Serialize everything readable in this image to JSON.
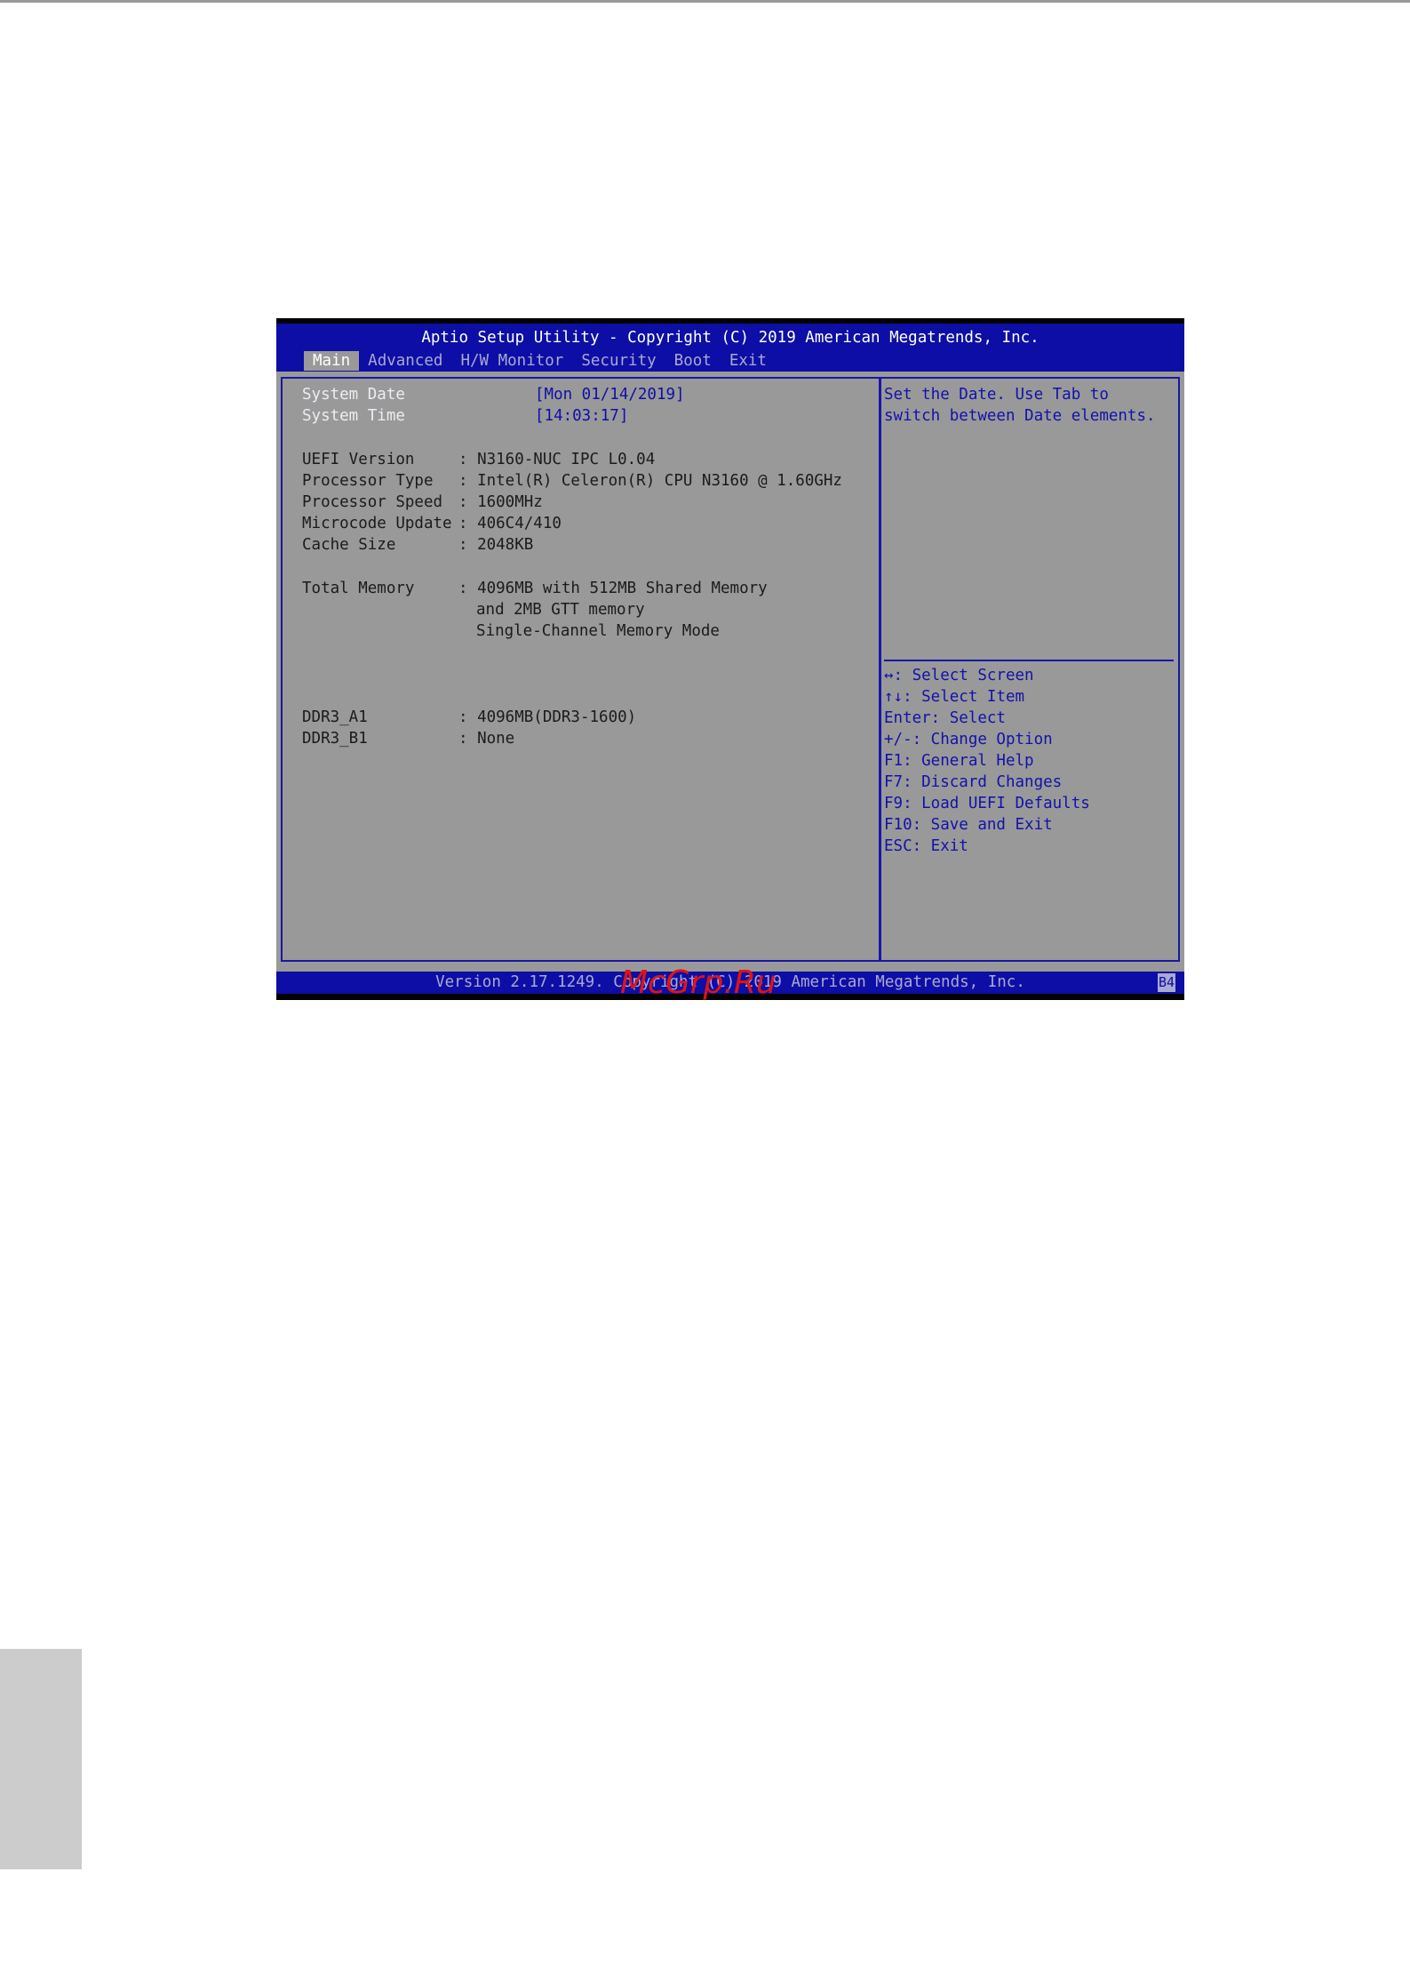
{
  "header": {
    "title": "Aptio Setup Utility - Copyright (C) 2019 American Megatrends, Inc.",
    "tabs": [
      "Main",
      "Advanced",
      "H/W Monitor",
      "Security",
      "Boot",
      "Exit"
    ],
    "active_tab": "Main"
  },
  "main": {
    "system_date_label": "System Date",
    "system_date_value": "[Mon 01/14/2019]",
    "system_time_label": "System Time",
    "system_time_value": "[14:03:17]",
    "info": [
      {
        "label": "UEFI Version",
        "value": ": N3160-NUC IPC L0.04"
      },
      {
        "label": "Processor Type",
        "value": ": Intel(R) Celeron(R) CPU N3160 @ 1.60GHz"
      },
      {
        "label": "Processor Speed",
        "value": ": 1600MHz"
      },
      {
        "label": "Microcode Update",
        "value": ": 406C4/410"
      },
      {
        "label": "Cache Size",
        "value": ": 2048KB"
      }
    ],
    "memory": {
      "label": "Total Memory",
      "lines": [
        ": 4096MB with 512MB Shared Memory",
        "and 2MB GTT memory",
        "Single-Channel Memory Mode"
      ]
    },
    "dimms": [
      {
        "label": "DDR3_A1",
        "value": ": 4096MB(DDR3-1600)"
      },
      {
        "label": "DDR3_B1",
        "value": ": None"
      }
    ]
  },
  "help": {
    "description": [
      "Set the Date. Use Tab to",
      "switch between Date elements."
    ],
    "keys": [
      "↔: Select Screen",
      "↑↓: Select Item",
      "Enter: Select",
      "+/-: Change Option",
      "F1: General Help",
      "F7: Discard Changes",
      "F9: Load UEFI Defaults",
      "F10: Save and Exit",
      "ESC: Exit"
    ]
  },
  "footer": {
    "version": "Version 2.17.1249. Copyright (C) 2019 American Megatrends, Inc.",
    "badge": "B4"
  },
  "watermark": "McGrp.Ru"
}
